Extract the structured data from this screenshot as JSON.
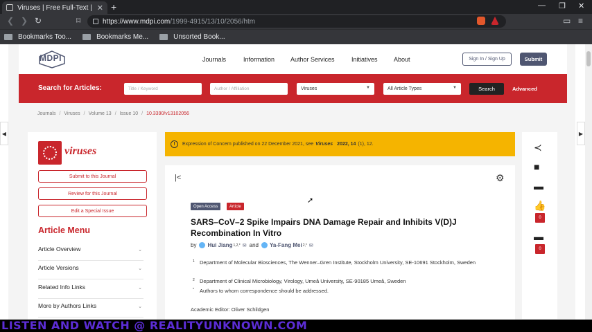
{
  "browser": {
    "tab_title": "Viruses | Free Full-Text | S",
    "tab_close": "✕",
    "new_tab": "+",
    "url_host": "https://www.mdpi.com",
    "url_path": "/1999-4915/13/10/2056/htm",
    "bookmarks": [
      "Bookmarks Too...",
      "Bookmarks Me...",
      "Unsorted Book..."
    ]
  },
  "header": {
    "logo": "MDPI",
    "nav": [
      "Journals",
      "Information",
      "Author Services",
      "Initiatives",
      "About"
    ],
    "signin": "Sign In / Sign Up",
    "submit": "Submit"
  },
  "search": {
    "label": "Search for Articles:",
    "title_placeholder": "Title / Keyword",
    "author_placeholder": "Author / Affiliation",
    "journal": "Viruses",
    "article_type": "All Article Types",
    "button": "Search",
    "advanced": "Advanced"
  },
  "breadcrumb": [
    "Journals",
    "Viruses",
    "Volume 13",
    "Issue 10",
    "10.3390/v13102056"
  ],
  "journal": {
    "name": "viruses",
    "buttons": [
      "Submit to this Journal",
      "Review for this Journal",
      "Edit a Special Issue"
    ],
    "menu_title": "Article Menu",
    "menu_items": [
      "Article Overview",
      "Article Versions",
      "Related Info Links",
      "More by Authors Links"
    ]
  },
  "alert": {
    "prefix": "Expression of Concern published on 22 December 2021, see",
    "journal": "Viruses",
    "ref": "2022, 14",
    "tail": "(1), 12."
  },
  "article": {
    "tag_open": "Open Access",
    "tag_type": "Article",
    "title": "SARS–CoV–2 Spike Impairs DNA Damage Repair and Inhibits V(D)J Recombination In Vitro",
    "by": "by",
    "author1": "Hui Jiang",
    "author1_sup": "1,2,*",
    "and": "and",
    "author2": "Ya-Fang Mei",
    "author2_sup": "2,*",
    "affiliations": [
      {
        "num": "1",
        "text": "Department of Molecular Biosciences, The Wenner–Gren Institute, Stockholm University, SE-10691 Stockholm, Sweden"
      },
      {
        "num": "2",
        "text": "Department of Clinical Microbiology, Virology, Umeå University, SE-90185 Umeå, Sweden"
      },
      {
        "num": "*",
        "text": "Authors to whom correspondence should be addressed."
      }
    ],
    "editor": "Academic Editor: Oliver Schildgen"
  },
  "right": {
    "count1": "0",
    "count2": "0"
  },
  "banner": "LISTEN AND WATCH @ REALITYUNKNOWN.COM",
  "colors": {
    "brand_red": "#c9262c",
    "brand_navy": "#4f5671",
    "alert_yellow": "#f5b400",
    "banner_text": "#5c2dd6"
  }
}
